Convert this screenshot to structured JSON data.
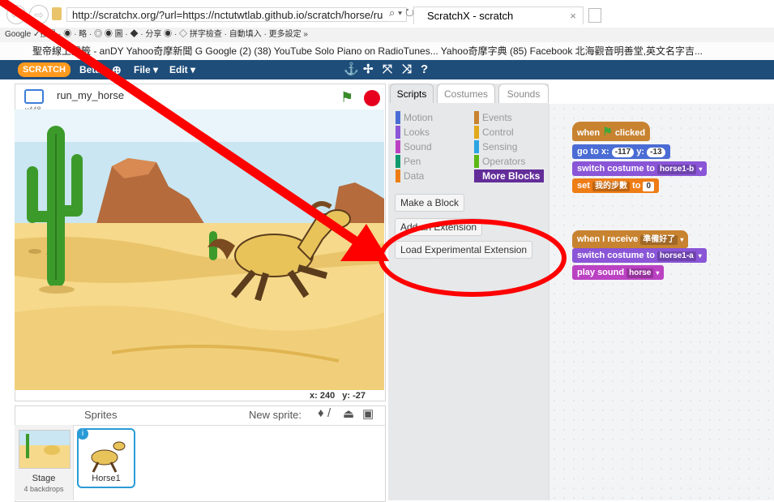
{
  "browser": {
    "url": "http://scratchx.org/?url=https://nctutwtlab.github.io/scratch/horse/ru",
    "tab_title": "ScratchX - scratch",
    "toolbar_text": "Google     ✓搜尋 · ◉ · 略 · ◎ ◉ 圖 · ◆ · 分享 ◉ · ◇   拼字檢查 · 自動填入 ·   更多設定 »",
    "bookmarks": "聖帝線上靈籤 - anDY   Yahoo奇摩新聞   G Google (2)   (38) YouTube   Solo Piano on RadioTunes...   Yahoo奇摩字典   (85) Facebook   北海觀音明善堂,英文名字吉..."
  },
  "menubar": {
    "logo": "SCRATCH",
    "beta": "Beta",
    "file": "File ▾",
    "edit": "Edit ▾"
  },
  "stage": {
    "project_name": "run_my_horse",
    "version": "v448",
    "coords_label_x": "x:",
    "coords_x": "240",
    "coords_label_y": "y:",
    "coords_y": "-27"
  },
  "palette": {
    "tabs": [
      "Scripts",
      "Costumes",
      "Sounds"
    ],
    "categories_left": [
      "Motion",
      "Looks",
      "Sound",
      "Pen",
      "Data"
    ],
    "categories_right": [
      "Events",
      "Control",
      "Sensing",
      "Operators",
      "More Blocks"
    ],
    "colors": {
      "motion": "#4a6cd4",
      "looks": "#8a55d7",
      "sound": "#bb42c3",
      "pen": "#0e9a6c",
      "data": "#ee7d16",
      "events": "#c88330",
      "control": "#e1a91a",
      "sensing": "#2ca5e2",
      "operators": "#5cb712",
      "more": "#632d99"
    },
    "buttons": {
      "make_block": "Make a Block",
      "add_extension": "Add an Extension",
      "load_experimental": "Load Experimental Extension"
    }
  },
  "scripts": {
    "script1": {
      "hat": "when",
      "hat2": "clicked",
      "goto": "go to x:",
      "x": "-117",
      "y_label": "y:",
      "y": "-13",
      "switch1": "switch costume to",
      "costume1": "horse1-b",
      "set": "set",
      "var": "我的步數",
      "to": "to",
      "val": "0"
    },
    "script2": {
      "receive": "when I receive",
      "msg": "準備好了",
      "switch2": "switch costume to",
      "costume2": "horse1-a",
      "play": "play sound",
      "sound": "horse"
    }
  },
  "sprites": {
    "header": "Sprites",
    "new_sprite": "New sprite:",
    "stage_label": "Stage",
    "backdrops": "4 backdrops",
    "horse_label": "Horse1"
  }
}
